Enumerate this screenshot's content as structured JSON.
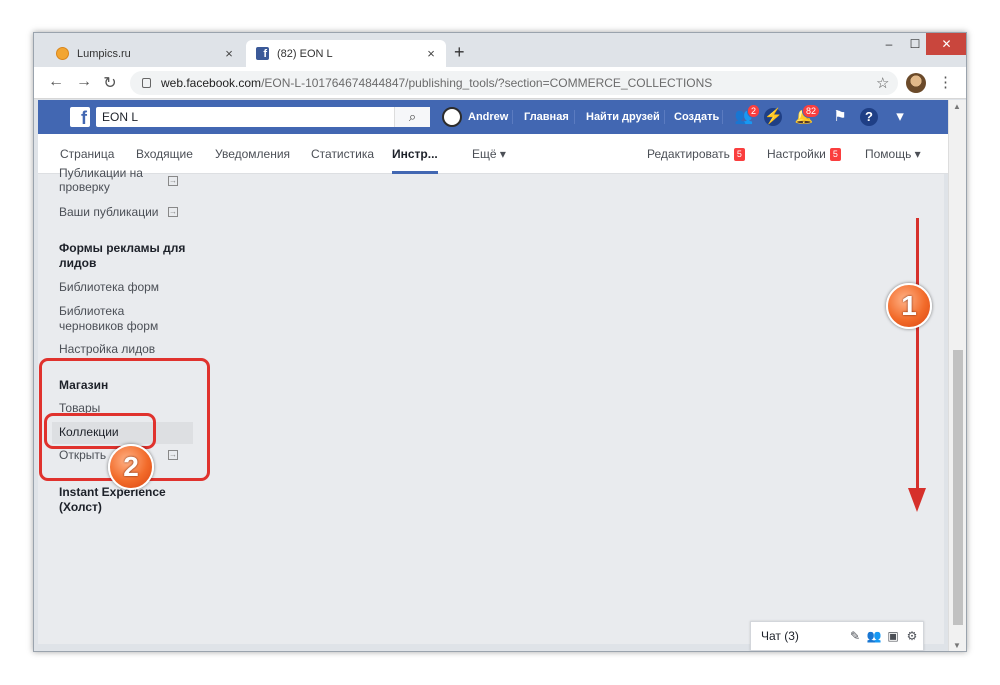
{
  "browser": {
    "tabs": [
      {
        "title": "Lumpics.ru",
        "close": "×"
      },
      {
        "title": "(82) EON L",
        "close": "×"
      }
    ],
    "new_tab": "+",
    "window_controls": {
      "minimize": "‒",
      "maximize": "☐",
      "close": "✕"
    },
    "nav": {
      "back": "←",
      "forward": "→",
      "reload": "↻"
    },
    "url_host": "web.facebook.com",
    "url_path": "/EON-L-101764674844847/publishing_tools/?section=COMMERCE_COLLECTIONS",
    "star": "☆",
    "menu": "⋮"
  },
  "fb_header": {
    "logo": "f",
    "search_value": "EON L",
    "search_icon": "⌕",
    "user_name": "Andrew",
    "nav": [
      "Главная",
      "Найти друзей",
      "Создать"
    ],
    "friends_badge": "2",
    "notifications_badge": "82",
    "dropdown": "▾"
  },
  "page_nav": {
    "items": [
      "Страница",
      "Входящие",
      "Уведомления",
      "Статистика",
      "Инстр...",
      "Ещё ▾"
    ],
    "right": [
      {
        "label": "Редактировать",
        "badge": "5"
      },
      {
        "label": "Настройки",
        "badge": "5"
      },
      {
        "label": "Помощь ▾"
      }
    ]
  },
  "sidebar": {
    "top_partial": "Публикации на",
    "top_partial_2": "проверку",
    "your_posts": "Ваши публикации",
    "lead_forms_heading_1": "Формы рекламы для",
    "lead_forms_heading_2": "лидов",
    "forms_library": "Библиотека форм",
    "drafts_library_1": "Библиотека",
    "drafts_library_2": "черновиков форм",
    "leads_setup": "Настройка лидов",
    "shop_heading": "Магазин",
    "products": "Товары",
    "collections": "Коллекции",
    "open": "Открыть",
    "instant_experience_1": "Instant Experience",
    "instant_experience_2": "(Холст)"
  },
  "chat": {
    "label": "Чат (3)"
  },
  "annotations": {
    "one": "1",
    "two": "2",
    "colors": {
      "red": "#e0322d",
      "orange": "#f26b2a"
    }
  }
}
